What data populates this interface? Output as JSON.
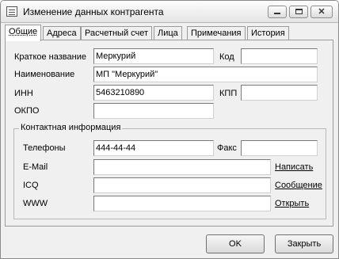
{
  "window": {
    "title": "Изменение данных контрагента"
  },
  "tabs": [
    {
      "label": "Общие",
      "active": true
    },
    {
      "label": "Адреса"
    },
    {
      "label": "Расчетный счет"
    },
    {
      "label": "Лица"
    },
    {
      "label": "Примечания"
    },
    {
      "label": "История"
    }
  ],
  "general": {
    "short_name_label": "Краткое название",
    "short_name_value": "Меркурий",
    "code_label": "Код",
    "code_value": "",
    "name_label": "Наименование",
    "name_value": "МП \"Меркурий\"",
    "inn_label": "ИНН",
    "inn_value": "5463210890",
    "kpp_label": "КПП",
    "kpp_value": "",
    "okpo_label": "ОКПО",
    "okpo_value": ""
  },
  "contact": {
    "group_title": "Контактная информация",
    "phones_label": "Телефоны",
    "phones_value": "444-44-44",
    "fax_label": "Факс",
    "fax_value": "",
    "email_label": "E-Mail",
    "email_value": "",
    "email_link": "Написать",
    "icq_label": "ICQ",
    "icq_value": "",
    "icq_link": "Сообщение",
    "www_label": "WWW",
    "www_value": "",
    "www_link": "Открыть"
  },
  "buttons": {
    "ok": "OK",
    "close": "Закрыть"
  }
}
